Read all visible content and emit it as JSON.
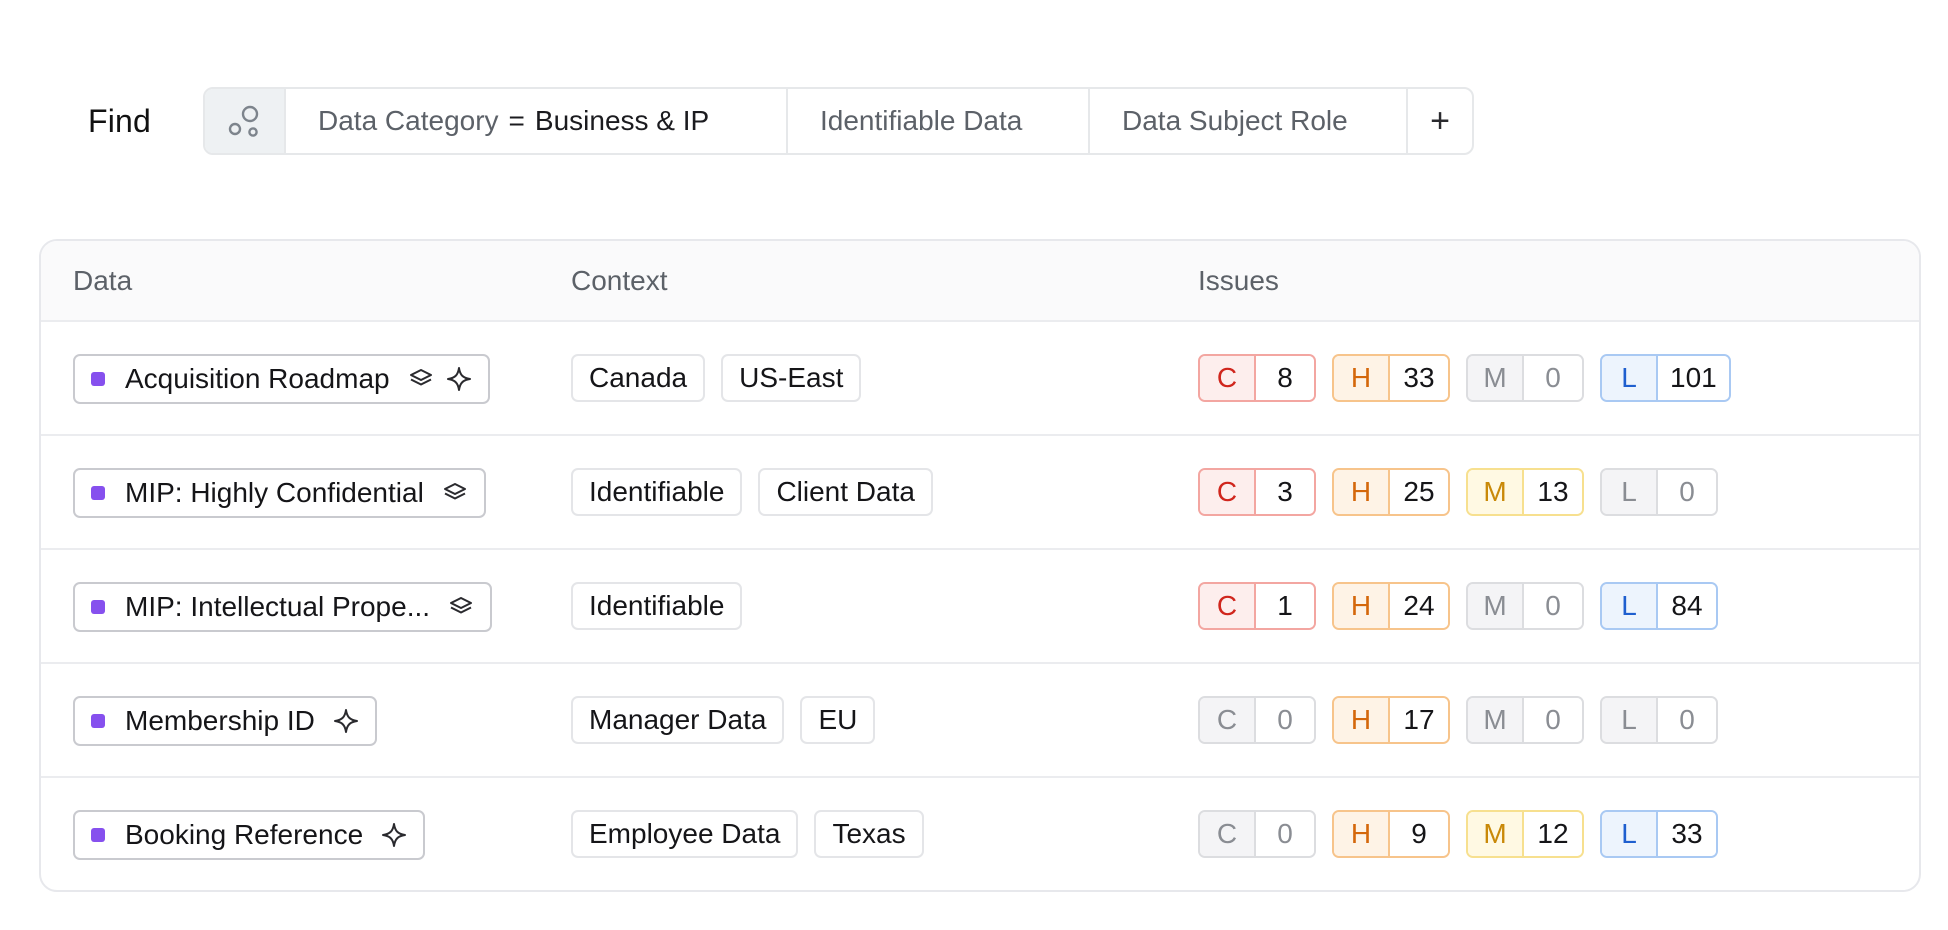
{
  "find": {
    "label": "Find",
    "filters": [
      {
        "key": "Data Category",
        "op": "=",
        "value": "Business & IP"
      },
      {
        "key": "Identifiable Data",
        "op": "",
        "value": ""
      },
      {
        "key": "Data Subject Role",
        "op": "",
        "value": ""
      }
    ],
    "add_label": "+"
  },
  "table": {
    "headers": {
      "data": "Data",
      "context": "Context",
      "issues": "Issues"
    },
    "rows": [
      {
        "name": "Acquisition Roadmap",
        "icons": [
          "layers-icon",
          "sparkle-icon"
        ],
        "context": [
          "Canada",
          "US-East"
        ],
        "issues": [
          {
            "level": "C",
            "count": "8"
          },
          {
            "level": "H",
            "count": "33"
          },
          {
            "level": "M",
            "count": "0"
          },
          {
            "level": "L",
            "count": "101"
          }
        ]
      },
      {
        "name": "MIP: Highly Confidential",
        "icons": [
          "layers-icon"
        ],
        "context": [
          "Identifiable",
          "Client Data"
        ],
        "issues": [
          {
            "level": "C",
            "count": "3"
          },
          {
            "level": "H",
            "count": "25"
          },
          {
            "level": "M",
            "count": "13"
          },
          {
            "level": "L",
            "count": "0"
          }
        ]
      },
      {
        "name": "MIP: Intellectual Prope...",
        "icons": [
          "layers-icon"
        ],
        "context": [
          "Identifiable"
        ],
        "issues": [
          {
            "level": "C",
            "count": "1"
          },
          {
            "level": "H",
            "count": "24"
          },
          {
            "level": "M",
            "count": "0"
          },
          {
            "level": "L",
            "count": "84"
          }
        ]
      },
      {
        "name": "Membership ID",
        "icons": [
          "sparkle-icon"
        ],
        "context": [
          "Manager Data",
          "EU"
        ],
        "issues": [
          {
            "level": "C",
            "count": "0"
          },
          {
            "level": "H",
            "count": "17"
          },
          {
            "level": "M",
            "count": "0"
          },
          {
            "level": "L",
            "count": "0"
          }
        ]
      },
      {
        "name": "Booking Reference",
        "icons": [
          "sparkle-icon"
        ],
        "context": [
          "Employee Data",
          "Texas"
        ],
        "issues": [
          {
            "level": "C",
            "count": "0"
          },
          {
            "level": "H",
            "count": "9"
          },
          {
            "level": "M",
            "count": "12"
          },
          {
            "level": "L",
            "count": "33"
          }
        ]
      }
    ]
  },
  "colors": {
    "dot": "#8650ee",
    "C": {
      "border": "#f3a6a1",
      "bg": "#fdeeed",
      "text": "#d0261d"
    },
    "H": {
      "border": "#f7c48b",
      "bg": "#fef3e6",
      "text": "#d4670b"
    },
    "M": {
      "border": "#f7e08f",
      "bg": "#fff9e3",
      "text": "#c98908"
    },
    "L": {
      "border": "#a9c9f3",
      "bg": "#edf4fd",
      "text": "#1f5fcf"
    },
    "zero": {
      "border": "#dcdde0",
      "bg": "#f4f4f6",
      "text": "#8a8d93"
    }
  }
}
